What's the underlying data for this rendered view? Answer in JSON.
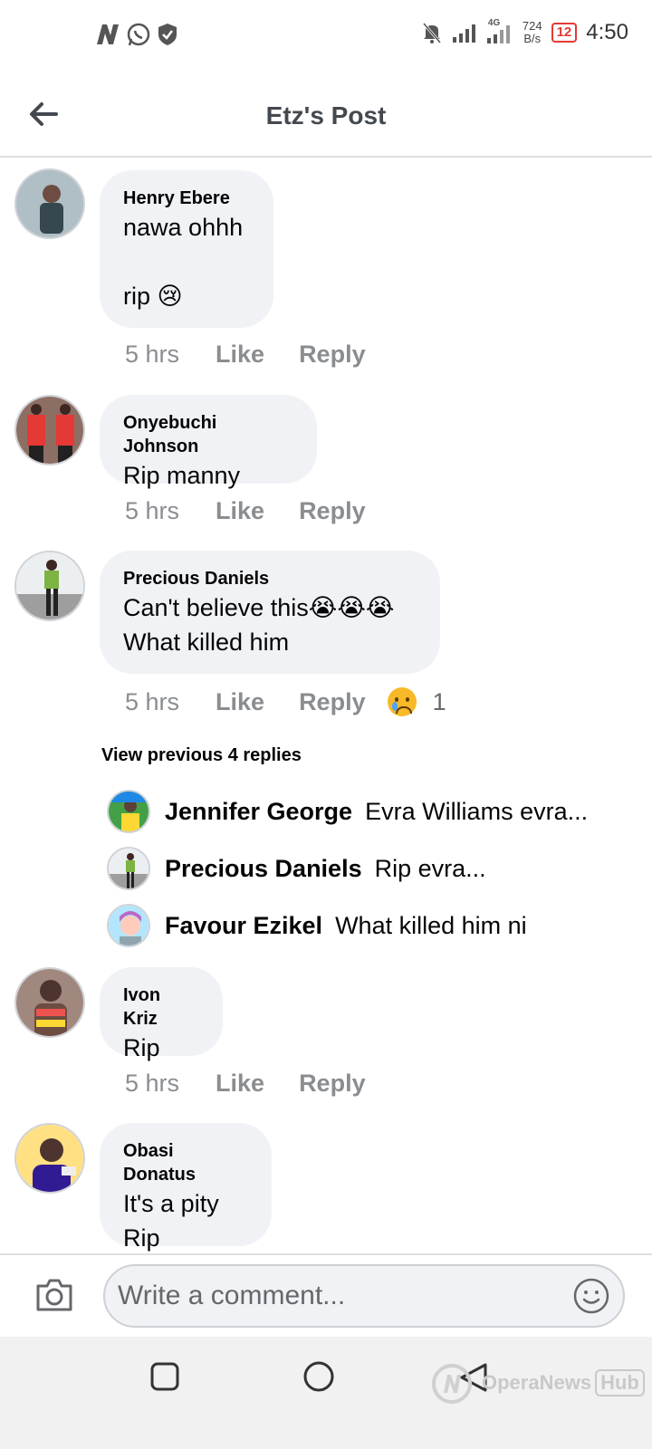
{
  "status_bar": {
    "time": "4:50",
    "net_speed_value": "724",
    "net_speed_unit": "B/s",
    "battery": "12",
    "network": "4G"
  },
  "header": {
    "title": "Etz's Post",
    "back_icon": "arrow-left-icon"
  },
  "comments": [
    {
      "author": "Henry Ebere",
      "text": "nawa ohhh\n\nrip 😢",
      "time": "5 hrs",
      "like": "Like",
      "reply": "Reply"
    },
    {
      "author": "Onyebuchi Johnson",
      "text": "Rip manny",
      "time": "5 hrs",
      "like": "Like",
      "reply": "Reply"
    },
    {
      "author": "Precious Daniels",
      "text": "Can't believe this😭😭😭\nWhat killed him",
      "time": "5 hrs",
      "like": "Like",
      "reply": "Reply",
      "reaction_count": "1"
    },
    {
      "author": "Ivon Kriz",
      "text": "Rip",
      "time": "5 hrs",
      "like": "Like",
      "reply": "Reply"
    },
    {
      "author": "Obasi Donatus",
      "text": "It's a pity\nRip"
    }
  ],
  "replies_section": {
    "view_previous": "View previous 4 replies",
    "replies": [
      {
        "name": "Jennifer George",
        "text": "Evra Williams evra..."
      },
      {
        "name": "Precious Daniels",
        "text": "Rip evra..."
      },
      {
        "name": "Favour Ezikel",
        "text": "What killed him ni"
      }
    ]
  },
  "composer": {
    "placeholder": "Write a comment...",
    "camera_icon": "camera-icon",
    "emoji_icon": "smiley-icon"
  },
  "watermark": {
    "brand": "OperaNews",
    "hub": "Hub"
  },
  "colors": {
    "bubble": "#f0f2f5",
    "meta_text": "#8a8d91",
    "divider": "#dddfe2"
  }
}
